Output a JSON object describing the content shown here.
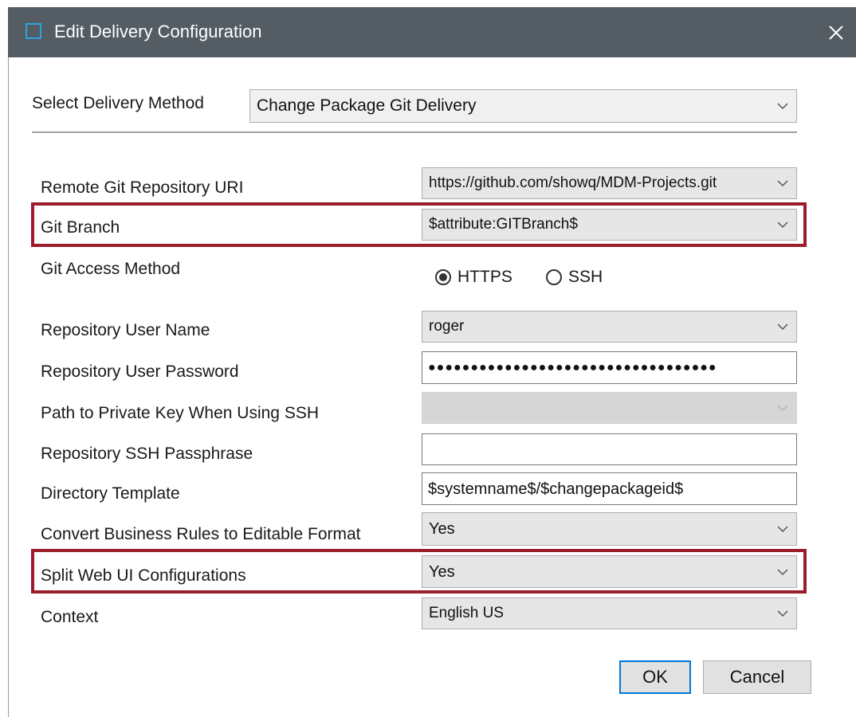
{
  "window": {
    "title": "Edit Delivery Configuration"
  },
  "delivery": {
    "label": "Select Delivery Method",
    "value": "Change Package Git Delivery"
  },
  "fields": {
    "remote_uri": {
      "label": "Remote Git Repository URI",
      "value": "https://github.com/showq/MDM-Projects.git"
    },
    "git_branch": {
      "label": "Git Branch",
      "value": "$attribute:GITBranch$"
    },
    "access_method": {
      "label": "Git Access Method",
      "options": [
        "HTTPS",
        "SSH"
      ],
      "selected": "HTTPS"
    },
    "user_name": {
      "label": "Repository User Name",
      "value": "roger"
    },
    "user_password": {
      "label": "Repository User Password",
      "value": "●●●●●●●●●●●●●●●●●●●●●●●●●●●●●●●●●●"
    },
    "private_key": {
      "label": "Path to Private Key When Using SSH",
      "value": ""
    },
    "ssh_passphrase": {
      "label": "Repository SSH Passphrase",
      "value": ""
    },
    "directory_template": {
      "label": "Directory Template",
      "value": "$systemname$/$changepackageid$"
    },
    "convert_rules": {
      "label": "Convert Business Rules to Editable Format",
      "value": "Yes"
    },
    "split_webui": {
      "label": "Split Web UI Configurations",
      "value": "Yes"
    },
    "context": {
      "label": "Context",
      "value": "English US"
    }
  },
  "buttons": {
    "ok": "OK",
    "cancel": "Cancel"
  },
  "colors": {
    "titlebar": "#545c64",
    "highlight": "#9b1c2a",
    "accent": "#0078d7"
  },
  "icons": {
    "app": "window-icon",
    "close": "close-icon",
    "dropdown": "chevron-down-icon",
    "radio": "radio-icon"
  }
}
